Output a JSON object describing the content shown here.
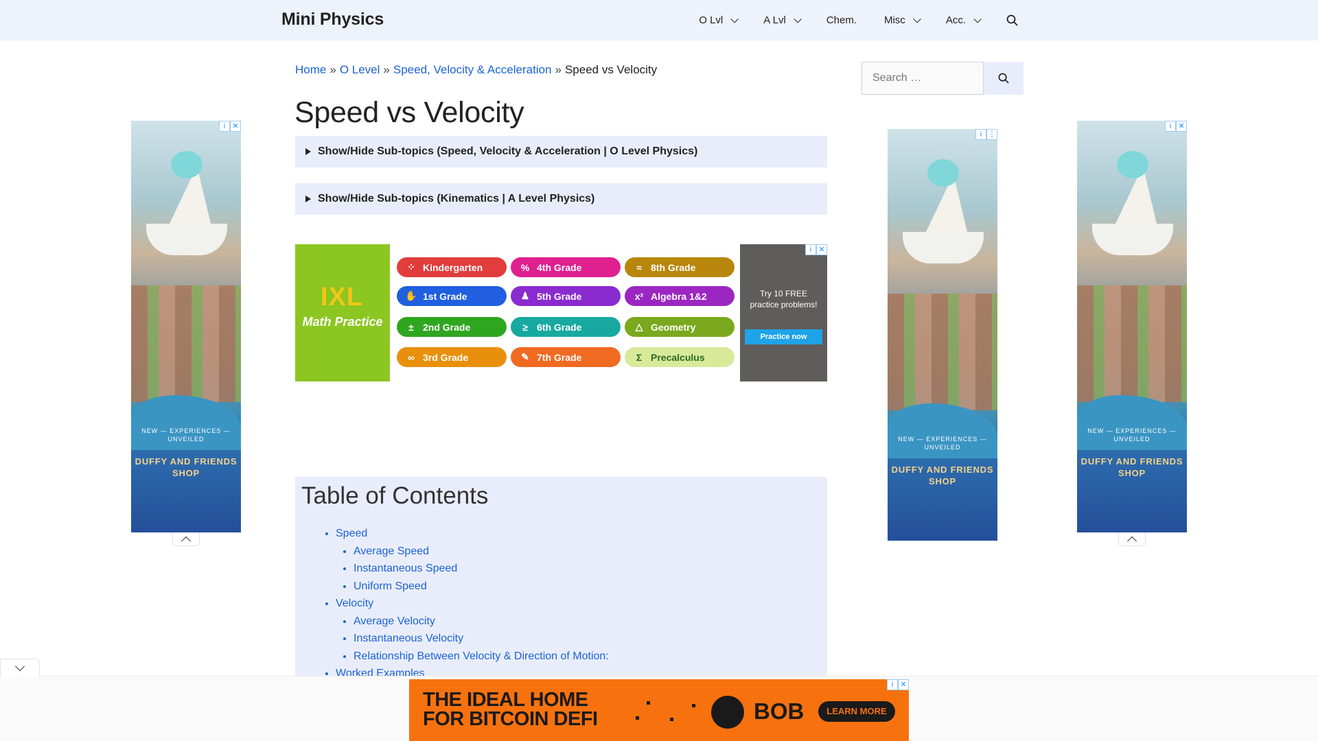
{
  "header": {
    "brand": "Mini Physics",
    "nav": [
      {
        "label": "O Lvl",
        "dropdown": true
      },
      {
        "label": "A Lvl",
        "dropdown": true
      },
      {
        "label": "Chem.",
        "dropdown": false
      },
      {
        "label": "Misc",
        "dropdown": true
      },
      {
        "label": "Acc.",
        "dropdown": true
      }
    ],
    "search_icon": "search-icon"
  },
  "breadcrumb": {
    "items": [
      "Home",
      "O Level",
      "Speed, Velocity & Acceleration"
    ],
    "separator": "»",
    "current": "Speed vs Velocity"
  },
  "page": {
    "title": "Speed vs Velocity",
    "toggles": [
      "Show/Hide Sub-topics (Speed, Velocity & Acceleration | O Level Physics)",
      "Show/Hide Sub-topics (Kinematics | A Level Physics)"
    ]
  },
  "ixl_ad": {
    "logo": "IXL",
    "tagline": "Math Practice",
    "pills": [
      {
        "label": "Kindergarten",
        "color": "#e23d3d",
        "icon": "⁘"
      },
      {
        "label": "4th Grade",
        "color": "#e0208f",
        "icon": "%"
      },
      {
        "label": "8th Grade",
        "color": "#b8860b",
        "icon": "≈"
      },
      {
        "label": "1st Grade",
        "color": "#1f5fe0",
        "icon": "✋"
      },
      {
        "label": "5th Grade",
        "color": "#8a2bd0",
        "icon": "♟"
      },
      {
        "label": "Algebra 1&2",
        "color": "#9b26c2",
        "icon": "x²"
      },
      {
        "label": "2nd Grade",
        "color": "#2ea61f",
        "icon": "±"
      },
      {
        "label": "6th Grade",
        "color": "#17a9a0",
        "icon": "≥"
      },
      {
        "label": "Geometry",
        "color": "#7aa81e",
        "icon": "△"
      },
      {
        "label": "3rd Grade",
        "color": "#e8900c",
        "icon": "∞"
      },
      {
        "label": "7th Grade",
        "color": "#f06a22",
        "icon": "✎"
      },
      {
        "label": "Precalculus",
        "color": "#d8ea9a",
        "icon": "Σ"
      }
    ],
    "side_text": "Try 10 FREE practice problems!",
    "side_button": "Practice now"
  },
  "toc": {
    "heading": "Table of Contents",
    "sections": [
      {
        "label": "Speed",
        "children": [
          "Average Speed",
          "Instantaneous Speed",
          "Uniform Speed"
        ]
      },
      {
        "label": "Velocity",
        "children": [
          "Average Velocity",
          "Instantaneous Velocity",
          "Relationship Between Velocity & Direction of Motion:"
        ]
      },
      {
        "label": "Worked Examples",
        "children": []
      }
    ]
  },
  "sidebar_search": {
    "placeholder": "Search …"
  },
  "side_ads": {
    "line1": "NEW — EXPERIENCES — UNVEILED",
    "line2": "DUFFY AND FRIENDS SHOP"
  },
  "bottom_ad": {
    "headline_1": "THE IDEAL HOME",
    "headline_2": "FOR BITCOIN DEFI",
    "brand": "BOB",
    "cta": "LEARN MORE"
  },
  "colors": {
    "header_bg": "#eef2fb",
    "link": "#1b63d6",
    "panel_bg": "#e9edfb",
    "bob_orange": "#f7720f",
    "ixl_green": "#8cc621"
  }
}
